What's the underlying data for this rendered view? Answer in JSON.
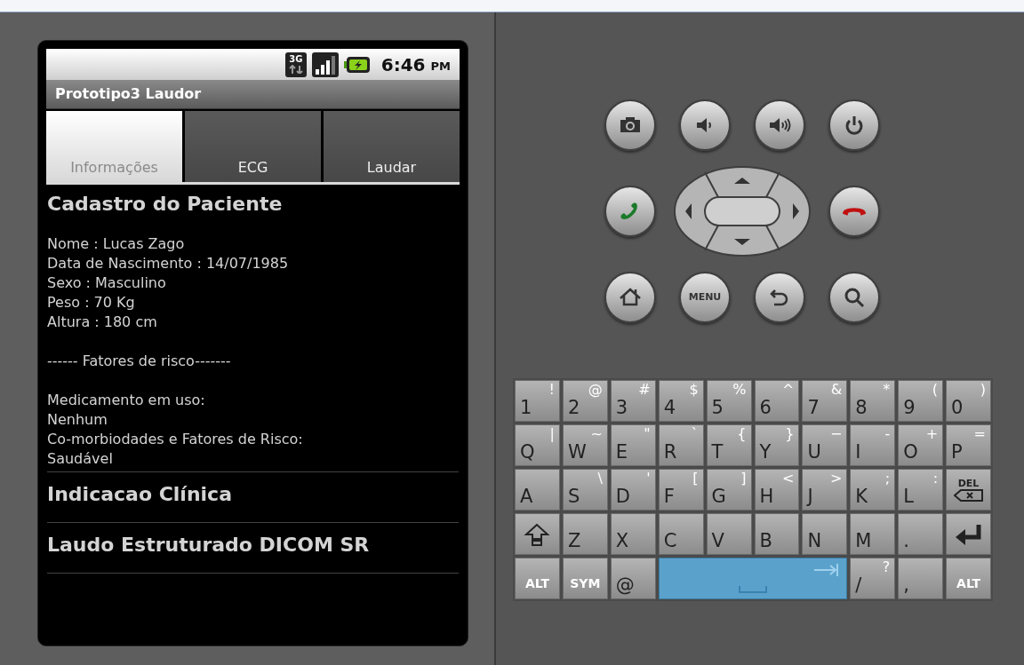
{
  "status_bar": {
    "network": "3G",
    "time": "6:46",
    "meridiem": "PM"
  },
  "app_title": "Prototipo3 Laudor",
  "tabs": [
    {
      "label": "Informações",
      "selected": true
    },
    {
      "label": "ECG",
      "selected": false
    },
    {
      "label": "Laudar",
      "selected": false
    }
  ],
  "content": {
    "heading": "Cadastro do Paciente",
    "patient_lines": [
      "Nome : Lucas Zago",
      "Data de Nascimento : 14/07/1985",
      "Sexo : Masculino",
      "Peso : 70 Kg",
      "Altura : 180 cm"
    ],
    "risk_header": "------ Fatores de risco-------",
    "risk_lines": [
      "Medicamento em uso:",
      "Nenhum",
      "Co-morbiodades e Fatores de Risco:",
      "Saudável"
    ],
    "sections": [
      "Indicacao Clínica",
      "Laudo Estruturado DICOM SR"
    ]
  },
  "hardware_keys": {
    "menu_label": "MENU"
  },
  "keyboard": [
    [
      {
        "kind": "char",
        "main": "1",
        "alt": "!"
      },
      {
        "kind": "char",
        "main": "2",
        "alt": "@"
      },
      {
        "kind": "char",
        "main": "3",
        "alt": "#"
      },
      {
        "kind": "char",
        "main": "4",
        "alt": "$"
      },
      {
        "kind": "char",
        "main": "5",
        "alt": "%"
      },
      {
        "kind": "char",
        "main": "6",
        "alt": "^"
      },
      {
        "kind": "char",
        "main": "7",
        "alt": "&"
      },
      {
        "kind": "char",
        "main": "8",
        "alt": "*"
      },
      {
        "kind": "char",
        "main": "9",
        "alt": "("
      },
      {
        "kind": "char",
        "main": "0",
        "alt": ")"
      }
    ],
    [
      {
        "kind": "char",
        "main": "Q",
        "alt": "|"
      },
      {
        "kind": "char",
        "main": "W",
        "alt": "~"
      },
      {
        "kind": "char",
        "main": "E",
        "alt": "\""
      },
      {
        "kind": "char",
        "main": "R",
        "alt": "`"
      },
      {
        "kind": "char",
        "main": "T",
        "alt": "{"
      },
      {
        "kind": "char",
        "main": "Y",
        "alt": "}"
      },
      {
        "kind": "char",
        "main": "U",
        "alt": "−"
      },
      {
        "kind": "char",
        "main": "I",
        "alt": "-"
      },
      {
        "kind": "char",
        "main": "O",
        "alt": "+"
      },
      {
        "kind": "char",
        "main": "P",
        "alt": "="
      }
    ],
    [
      {
        "kind": "char",
        "main": "A"
      },
      {
        "kind": "char",
        "main": "S",
        "alt": "\\"
      },
      {
        "kind": "char",
        "main": "D",
        "alt": "'"
      },
      {
        "kind": "char",
        "main": "F",
        "alt": "["
      },
      {
        "kind": "char",
        "main": "G",
        "alt": "]"
      },
      {
        "kind": "char",
        "main": "H",
        "alt": "<"
      },
      {
        "kind": "char",
        "main": "J",
        "alt": ">"
      },
      {
        "kind": "char",
        "main": "K",
        "alt": ";"
      },
      {
        "kind": "char",
        "main": "L",
        "alt": ":"
      },
      {
        "kind": "delete",
        "main": "DEL"
      }
    ],
    [
      {
        "kind": "shift"
      },
      {
        "kind": "char",
        "main": "Z"
      },
      {
        "kind": "char",
        "main": "X"
      },
      {
        "kind": "char",
        "main": "C"
      },
      {
        "kind": "char",
        "main": "V"
      },
      {
        "kind": "char",
        "main": "B"
      },
      {
        "kind": "char",
        "main": "N"
      },
      {
        "kind": "char",
        "main": "M"
      },
      {
        "kind": "char",
        "main": "."
      },
      {
        "kind": "enter"
      }
    ],
    [
      {
        "kind": "modifier",
        "main": "ALT"
      },
      {
        "kind": "modifier",
        "main": "SYM"
      },
      {
        "kind": "char",
        "main": "@"
      },
      {
        "kind": "space"
      },
      {
        "kind": "char",
        "main": "/",
        "alt": "?"
      },
      {
        "kind": "char",
        "main": ","
      },
      {
        "kind": "modifier",
        "main": "ALT"
      }
    ]
  ]
}
